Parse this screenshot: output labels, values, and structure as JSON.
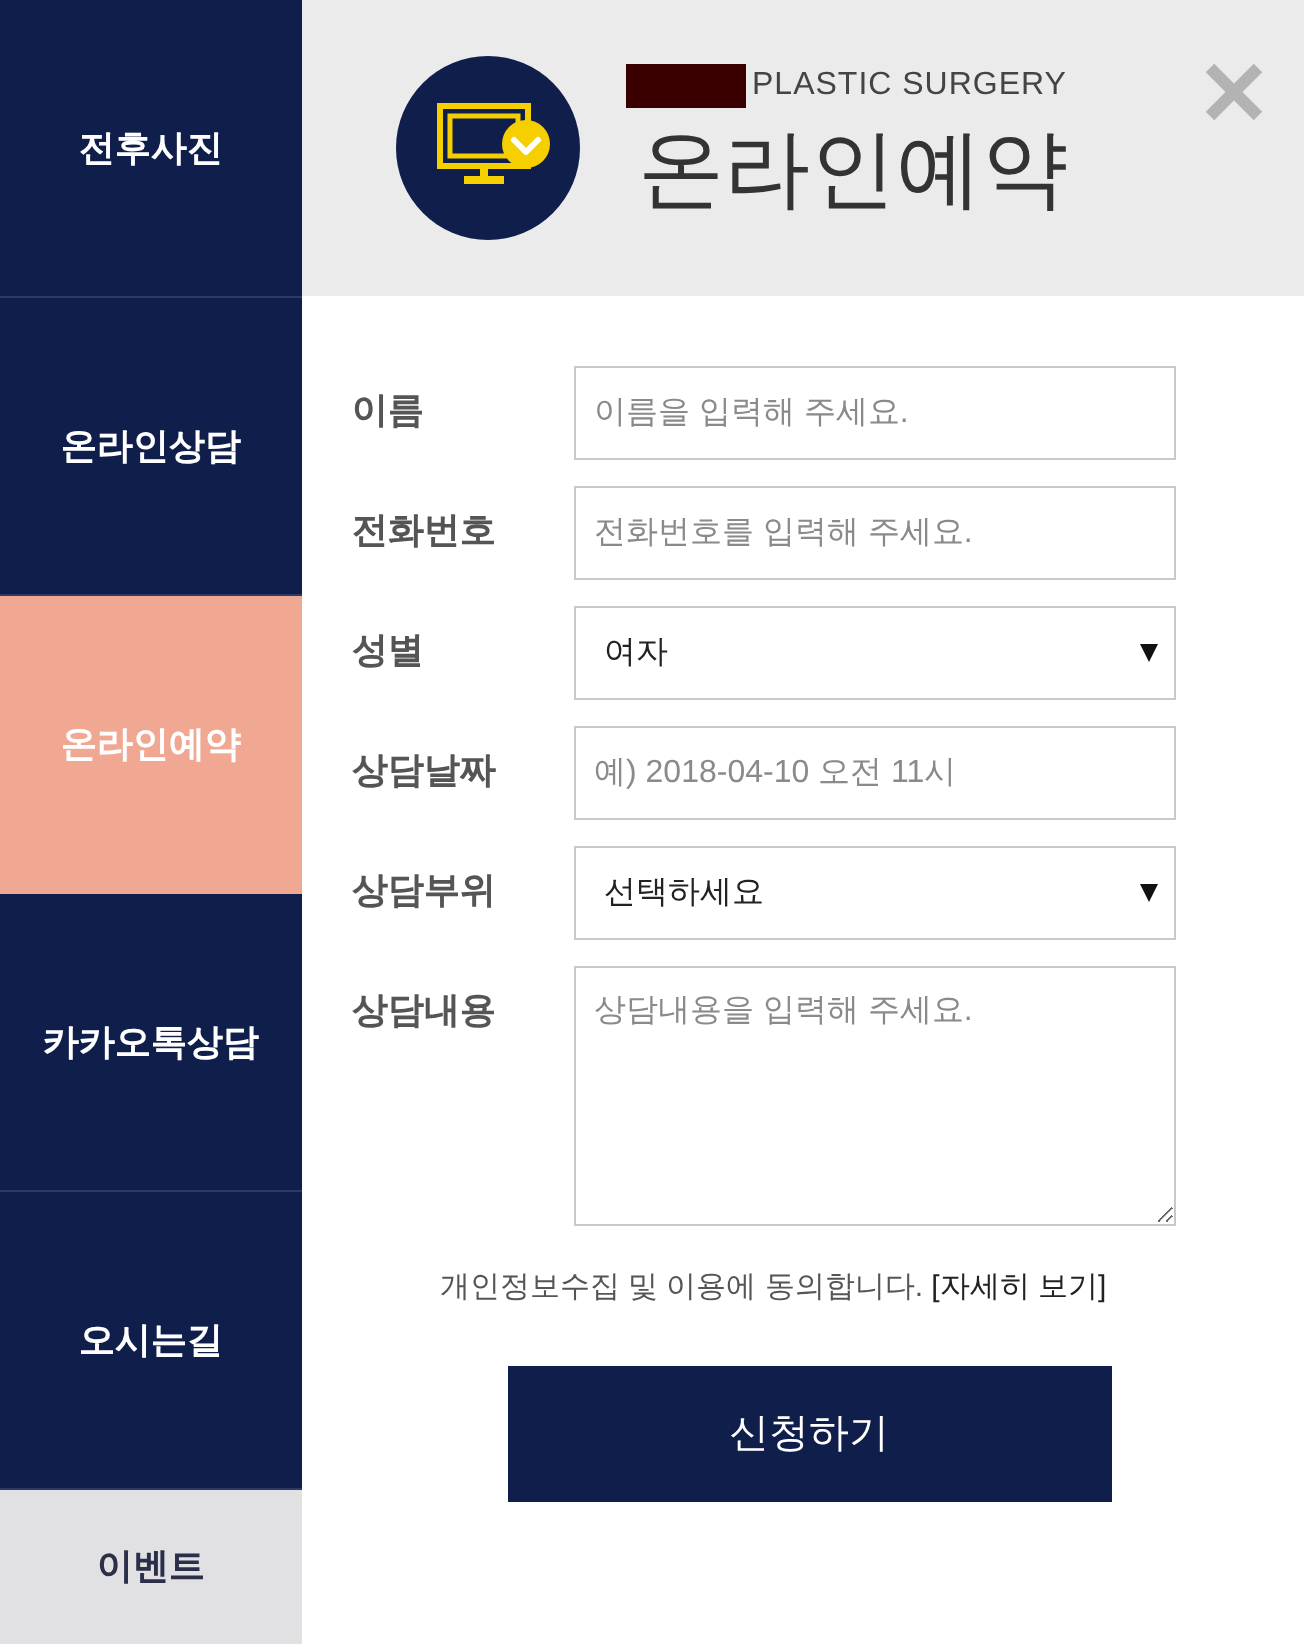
{
  "sidebar": {
    "items": [
      {
        "label": "전후사진",
        "kind": "nav",
        "selected": false
      },
      {
        "label": "온라인상담",
        "kind": "nav",
        "selected": false
      },
      {
        "label": "온라인예약",
        "kind": "nav",
        "selected": true
      },
      {
        "label": "카카오톡상담",
        "kind": "nav",
        "selected": false
      },
      {
        "label": "오시는길",
        "kind": "nav",
        "selected": false
      },
      {
        "label": "이벤트",
        "kind": "event",
        "selected": false
      }
    ]
  },
  "header": {
    "subtitle": "PLASTIC SURGERY",
    "title": "온라인예약"
  },
  "form": {
    "fields": [
      {
        "label": "이름",
        "kind": "text",
        "placeholder": "이름을 입력해 주세요."
      },
      {
        "label": "전화번호",
        "kind": "text",
        "placeholder": "전화번호를 입력해 주세요."
      },
      {
        "label": "성별",
        "kind": "select",
        "value": "여자"
      },
      {
        "label": "상담날짜",
        "kind": "text",
        "placeholder": "예) 2018-04-10 오전 11시"
      },
      {
        "label": "상담부위",
        "kind": "select",
        "value": "선택하세요"
      },
      {
        "label": "상담내용",
        "kind": "textarea",
        "placeholder": "상담내용을 입력해 주세요."
      }
    ]
  },
  "consent": {
    "text": "개인정보수집 및 이용에 동의합니다.",
    "link": "[자세히 보기]"
  },
  "submit_button": {
    "label": "신청하기"
  }
}
